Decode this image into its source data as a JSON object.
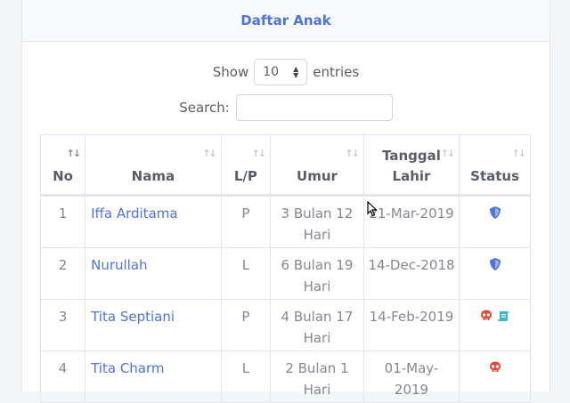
{
  "header": {
    "title": "Daftar Anak"
  },
  "length": {
    "show_label": "Show",
    "value": "10",
    "entries_label": "entries"
  },
  "search": {
    "label": "Search:",
    "value": ""
  },
  "table": {
    "columns": [
      "No",
      "Nama",
      "L/P",
      "Umur",
      "Tanggal Lahir",
      "Status"
    ],
    "rows": [
      {
        "no": "1",
        "nama": "Iffa Arditama",
        "lp": "P",
        "umur": "3 Bulan 12 Hari",
        "lahir": "21-Mar-2019",
        "status": [
          "shield-icon"
        ]
      },
      {
        "no": "2",
        "nama": "Nurullah",
        "lp": "L",
        "umur": "6 Bulan 19 Hari",
        "lahir": "14-Dec-2018",
        "status": [
          "shield-icon"
        ]
      },
      {
        "no": "3",
        "nama": "Tita Septiani",
        "lp": "P",
        "umur": "4 Bulan 17 Hari",
        "lahir": "14-Feb-2019",
        "status": [
          "skull-icon",
          "scroll-icon"
        ]
      },
      {
        "no": "4",
        "nama": "Tita Charm",
        "lp": "L",
        "umur": "2 Bulan 1 Hari",
        "lahir": "01-May-2019",
        "status": [
          "skull-icon"
        ]
      }
    ]
  },
  "colors": {
    "primary": "#4e73df",
    "danger": "#e74a3b",
    "info": "#36b9cc",
    "text": "#858796"
  }
}
